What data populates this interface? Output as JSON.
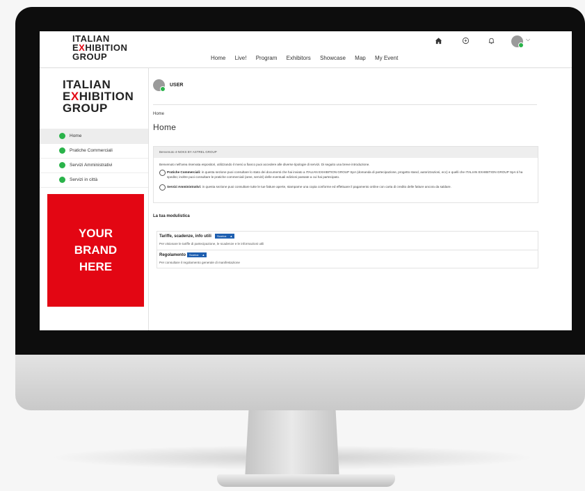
{
  "header": {
    "logo_lines": [
      "ITALIAN",
      "EXHIBITION",
      "GROUP"
    ],
    "nav": [
      "Home",
      "Live!",
      "Program",
      "Exhibitors",
      "Showcase",
      "Map",
      "My Event"
    ],
    "icons": [
      "home-icon",
      "chat-icon",
      "bell-icon"
    ],
    "avatar_status_color": "#2ab34a"
  },
  "sidebar": {
    "logo_lines": [
      "ITALIAN",
      "EXHIBITION",
      "GROUP"
    ],
    "items": [
      {
        "label": "Home",
        "active": true
      },
      {
        "label": "Pratiche Commerciali"
      },
      {
        "label": "Servizi Amministrativi"
      },
      {
        "label": "Servizi in città"
      }
    ],
    "brand_lines": [
      "YOUR",
      "BRAND",
      "HERE"
    ],
    "brand_color": "#e30613"
  },
  "main": {
    "username": "USER",
    "breadcrumb": "Home",
    "title": "Home",
    "welcome_header": "Benvenuto 4-NOKS BY ASTREL GROUP",
    "intro": "Benvenuto nell'area riservata espositori, utilizzando il menù a fianco puoi accedere alle diverse tipologie di servizi. Di seguito una breve introduzione.",
    "bullets": [
      {
        "title": "Pratiche Commerciali:",
        "text": " in questa sezione puoi consultare lo stato dei documenti che hai inviato a ITALIAN EXHIBITION GROUP SpA (domanda di partecipazione, progetto stand, autorizzazioni, ecc) e quelli che ITALIAN EXHIBITION GROUP SpA ti ha spedito; inoltre puoi consultare le pratiche commerciali (aree, servizi) delle eventuali edizioni passate a cui hai partecipato."
      },
      {
        "title": "Servizi Amministrativi:",
        "text": " in questa sezione puoi consultare tutte le tue fatture aperte, stamparne una copia conforme ed effettuare il pagamento online con carta di credito delle fatture ancora da saldare."
      }
    ],
    "modulistica_title": "La tua modulistica",
    "modules": [
      {
        "title": "Tariffe, scadenze, info utili",
        "button": "Scarica",
        "description": "Per visionare le tariffe di partecipazione, le scadenze e le informazioni utili"
      },
      {
        "title": "Regolamento",
        "button": "Scarica",
        "description": "Per consultare il regolamento generale di manifestazione"
      }
    ]
  }
}
